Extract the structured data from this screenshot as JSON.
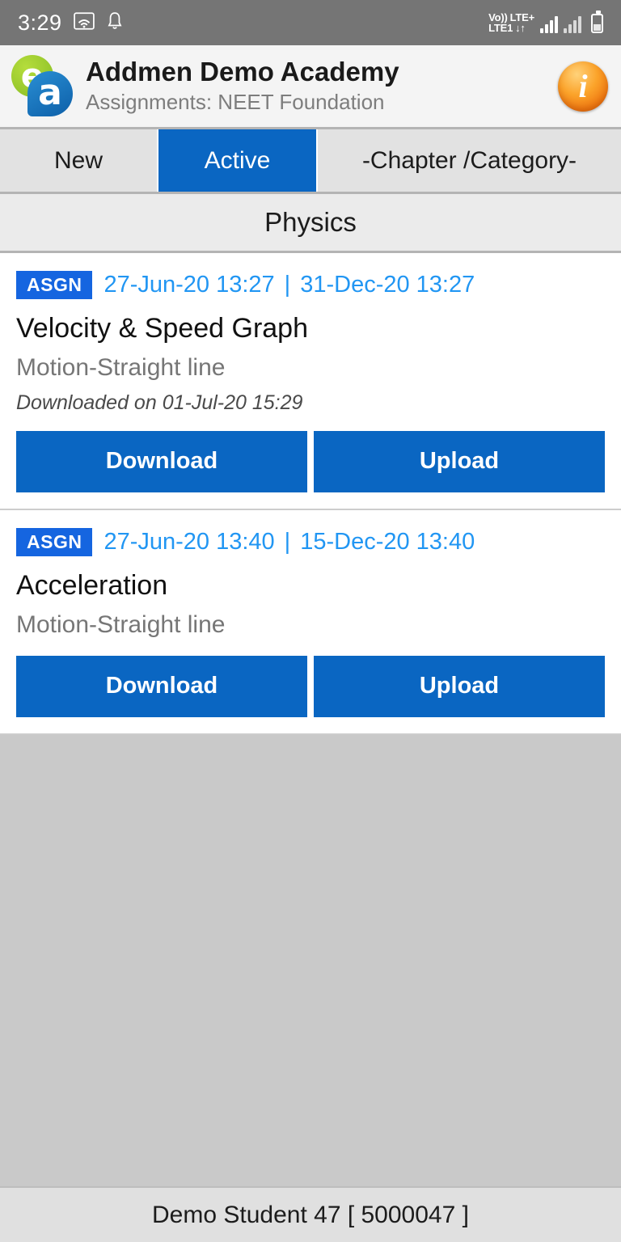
{
  "status_bar": {
    "time": "3:29",
    "wifi_icon": "wifi-icon",
    "notification_icon": "bell-icon",
    "volte_line1": "Vo))",
    "volte_line2": "LTE1",
    "network_label": "LTE+",
    "data_arrows": "↓↑",
    "battery_icon": "battery-icon"
  },
  "header": {
    "logo_e": "e",
    "logo_a": "a",
    "title": "Addmen Demo Academy",
    "subtitle": "Assignments: NEET Foundation",
    "info_icon_glyph": "i"
  },
  "tabs": [
    {
      "label": "New",
      "active": false
    },
    {
      "label": "Active",
      "active": true
    },
    {
      "label": "-Chapter /Category-",
      "active": false
    }
  ],
  "section": {
    "title": "Physics"
  },
  "assignments": [
    {
      "badge": "ASGN",
      "start_date": "27-Jun-20 13:27",
      "separator": "|",
      "end_date": "31-Dec-20 13:27",
      "title": "Velocity & Speed Graph",
      "chapter": "Motion-Straight line",
      "note": "Downloaded on 01-Jul-20 15:29",
      "download_label": "Download",
      "upload_label": "Upload"
    },
    {
      "badge": "ASGN",
      "start_date": "27-Jun-20 13:40",
      "separator": "|",
      "end_date": "15-Dec-20 13:40",
      "title": "Acceleration",
      "chapter": "Motion-Straight line",
      "note": "",
      "download_label": "Download",
      "upload_label": "Upload"
    }
  ],
  "footer": {
    "student": "Demo Student 47 [ 5000047 ]"
  },
  "colors": {
    "accent_blue": "#0a66c2",
    "badge_blue": "#1565e0",
    "date_blue": "#2196f3",
    "status_gray": "#757575",
    "body_gray": "#c9c9c9",
    "logo_green": "#86bb23",
    "info_orange": "#f07c13"
  }
}
